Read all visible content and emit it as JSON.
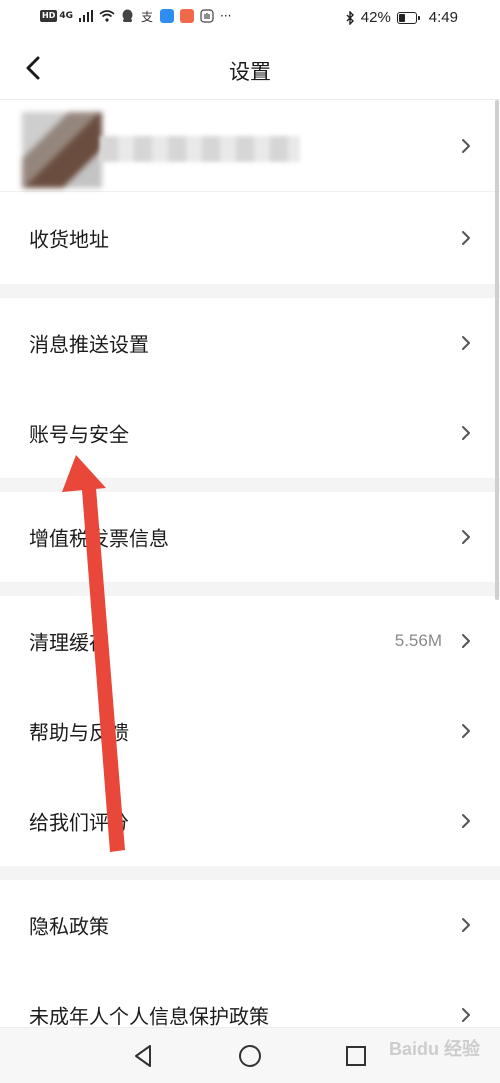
{
  "status_bar": {
    "left_badge": "HD",
    "network": "4G",
    "more": "···",
    "battery_percent": "42%",
    "battery_level": 0.42,
    "time": "4:49"
  },
  "header": {
    "title": "设置"
  },
  "menu": {
    "address": "收货地址",
    "notifications": "消息推送设置",
    "account_security": "账号与安全",
    "vat_invoice": "增值税发票信息",
    "clear_cache": "清理缓存",
    "cache_size": "5.56M",
    "help_feedback": "帮助与反馈",
    "rate_us": "给我们评分",
    "privacy_policy": "隐私政策",
    "minor_privacy": "未成年人个人信息保护政策"
  },
  "watermark": "Baidu 经验",
  "colors": {
    "arrow": "#e8473a",
    "background": "#f4f4f4",
    "card": "#ffffff"
  },
  "icons": {
    "back": "chevron-left-icon",
    "row_arrow": "chevron-right-icon",
    "nav_back": "triangle-back-icon",
    "nav_home": "circle-home-icon",
    "nav_recent": "square-recent-icon"
  }
}
